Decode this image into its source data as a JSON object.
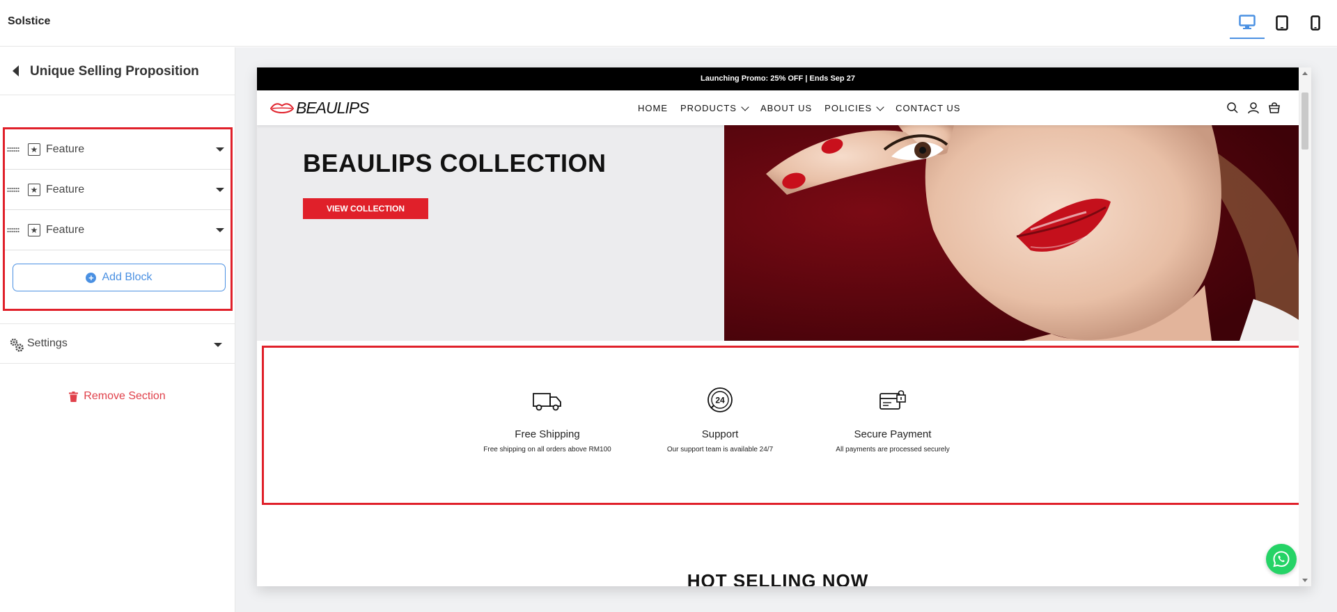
{
  "app": {
    "title": "Solstice",
    "devices": [
      "desktop-icon",
      "tablet-icon",
      "mobile-icon"
    ],
    "active_device": "desktop"
  },
  "sidebar": {
    "title": "Unique Selling Proposition",
    "blocks": [
      {
        "label": "Feature",
        "icon": "star-box-icon"
      },
      {
        "label": "Feature",
        "icon": "star-box-icon"
      },
      {
        "label": "Feature",
        "icon": "star-box-icon"
      }
    ],
    "add_block_label": "Add Block",
    "settings_label": "Settings",
    "remove_section_label": "Remove Section"
  },
  "preview": {
    "promo": "Launching Promo: 25% OFF | Ends Sep 27",
    "logo_text": "BEAULIPS",
    "nav": [
      {
        "label": "HOME",
        "dropdown": false
      },
      {
        "label": "PRODUCTS",
        "dropdown": true
      },
      {
        "label": "ABOUT US",
        "dropdown": false
      },
      {
        "label": "POLICIES",
        "dropdown": true
      },
      {
        "label": "CONTACT US",
        "dropdown": false
      }
    ],
    "hero": {
      "title": "BEAULIPS COLLECTION",
      "button": "VIEW COLLECTION"
    },
    "features": [
      {
        "title": "Free Shipping",
        "desc": "Free shipping on all orders above RM100",
        "icon": "truck-icon"
      },
      {
        "title": "Support",
        "desc": "Our support team is available 24/7",
        "icon": "support-24-icon"
      },
      {
        "title": "Secure Payment",
        "desc": "All payments are processed securely",
        "icon": "secure-card-icon"
      }
    ],
    "next_section_title": "HOT SELLING NOW"
  },
  "colors": {
    "accent": "#4a90e2",
    "brand_red": "#e0202a",
    "whatsapp": "#25d366"
  }
}
